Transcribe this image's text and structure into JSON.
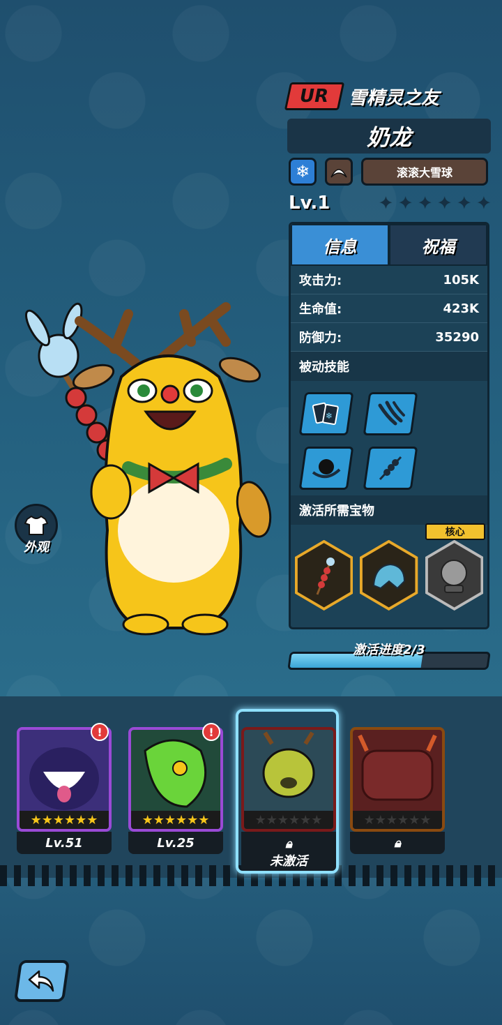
{
  "header": {
    "rarity": "UR",
    "title": "雪精灵之友",
    "name": "奶龙",
    "element_icon": "snowflake-icon",
    "type_icon": "boomerang-icon",
    "skill_name": "滚滚大雪球",
    "level": "Lv.1",
    "star_count": 6
  },
  "panel": {
    "tabs": [
      {
        "label": "信息",
        "active": true
      },
      {
        "label": "祝福",
        "active": false
      }
    ],
    "stats": [
      {
        "label": "攻击力:",
        "value": "105K"
      },
      {
        "label": "生命值:",
        "value": "423K"
      },
      {
        "label": "防御力:",
        "value": "35290"
      }
    ],
    "passive_title": "被动技能",
    "passive_skills": [
      "cards-icon",
      "claw-icon",
      "black-hole-icon",
      "skewer-icon"
    ],
    "treasure_title": "激活所需宝物",
    "treasures": [
      {
        "icon": "candy-skewer-icon",
        "frame": "gold"
      },
      {
        "icon": "ice-helmet-icon",
        "frame": "gold"
      },
      {
        "icon": "crystal-ball-icon",
        "frame": "gray",
        "tag": "核心"
      }
    ]
  },
  "progress": {
    "label": "激活进度2/3",
    "fraction": 0.667
  },
  "outfit": {
    "label": "外观"
  },
  "roster": [
    {
      "label": "Lv.51",
      "stars": 6,
      "locked": false,
      "alert": "!",
      "color": "#3c2f7a"
    },
    {
      "label": "Lv.25",
      "stars": 6,
      "locked": false,
      "alert": "!",
      "color": "#214a3a"
    },
    {
      "label": "未激活",
      "stars": 6,
      "locked": true,
      "selected": true,
      "color": "#2c4a57"
    },
    {
      "label": "",
      "stars": 6,
      "locked": true,
      "color": "#5a2020"
    }
  ],
  "back_button": {
    "icon": "back-arrow-icon"
  }
}
